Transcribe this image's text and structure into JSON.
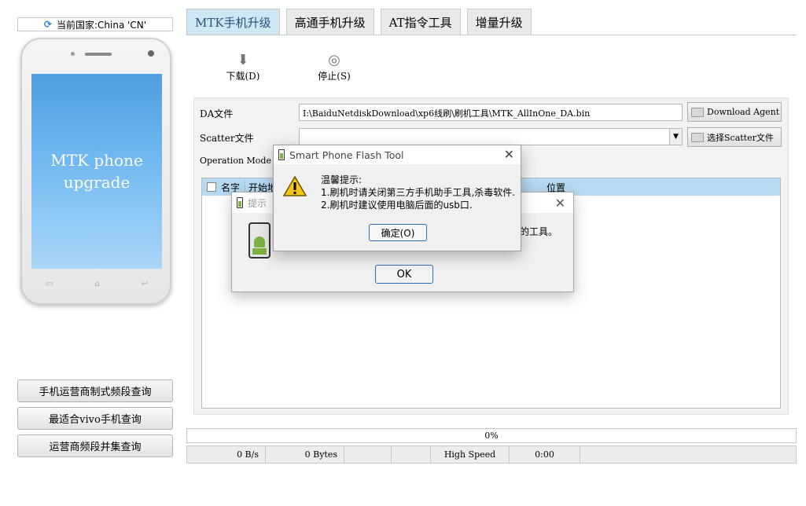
{
  "country": {
    "label": "当前国家:China 'CN'"
  },
  "phone": {
    "screen_line1": "MTK phone",
    "screen_line2": "upgrade"
  },
  "left_buttons": [
    "手机运营商制式频段查询",
    "最适合vivo手机查询",
    "运营商频段并集查询"
  ],
  "tabs": [
    "MTK手机升级",
    "高通手机升级",
    "AT指令工具",
    "增量升级"
  ],
  "toolbar": {
    "download": "下载(D)",
    "stop": "停止(S)"
  },
  "form": {
    "da_label": "DA文件",
    "da_path": "I:\\BaiduNetdiskDownload\\xp6线刷\\刷机工具\\MTK_AllInOne_DA.bin",
    "download_agent_button": "Download Agent",
    "scatter_label": "Scatter文件",
    "scatter_button": "选择Scatter文件",
    "operation_mode_label": "Operation Mode"
  },
  "table": {
    "col_name": "名字",
    "col_start": "开始地",
    "col_location": "位置"
  },
  "progress": {
    "text": "0%"
  },
  "status": {
    "speed": "0 B/s",
    "bytes": "0 Bytes",
    "mode": "High Speed",
    "time": "0:00"
  },
  "dialog_back": {
    "title": "提示",
    "text_tail": "版的工具。",
    "ok": "OK"
  },
  "dialog_front": {
    "title": "Smart Phone Flash Tool",
    "line1": "温馨提示:",
    "line2": "1.刷机时请关闭第三方手机助手工具,杀毒软件.",
    "line3": "2.刷机时建议使用电脑后面的usb口.",
    "confirm": "确定(O)"
  }
}
